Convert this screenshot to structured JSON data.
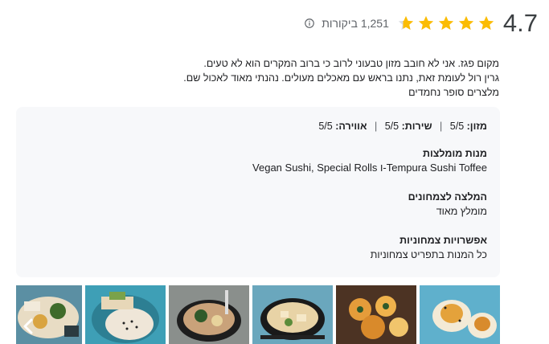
{
  "rating": {
    "score": "4.7",
    "stars_filled": 4.7,
    "reviews_label": "1,251 ביקורות",
    "colors": {
      "star": "#fbbc04",
      "star_empty": "#dadce0"
    }
  },
  "description": {
    "line1": "מקום פגז. אני לא חובב מזון טבעוני לרוב כי ברוב המקרים הוא לא טעים.",
    "line2": "גרין רול לעומת זאת, נתנו בראש עם מאכלים מעולים. נהנתי מאוד לאכול שם.",
    "line3": "מלצרים סופר נחמדים"
  },
  "details": {
    "food_label": "מזון:",
    "food_value": "5/5",
    "service_label": "שירות:",
    "service_value": "5/5",
    "atmosphere_label": "אווירה:",
    "atmosphere_value": "5/5",
    "separator": "|",
    "recommended_title": "מנות מומלצות",
    "recommended_value": "Tempura Sushi Toffee-ו Vegan Sushi, Special Rolls",
    "veg_rec_title": "המלצה לצמחונים",
    "veg_rec_value": "מומלץ מאוד",
    "veg_options_title": "אפשרויות צמחוניות",
    "veg_options_value": "כל המנות בתפריט צמחוניות"
  },
  "photos": {
    "icons": [
      "food-photo-icon"
    ],
    "nav": "chevron-left-icon"
  }
}
